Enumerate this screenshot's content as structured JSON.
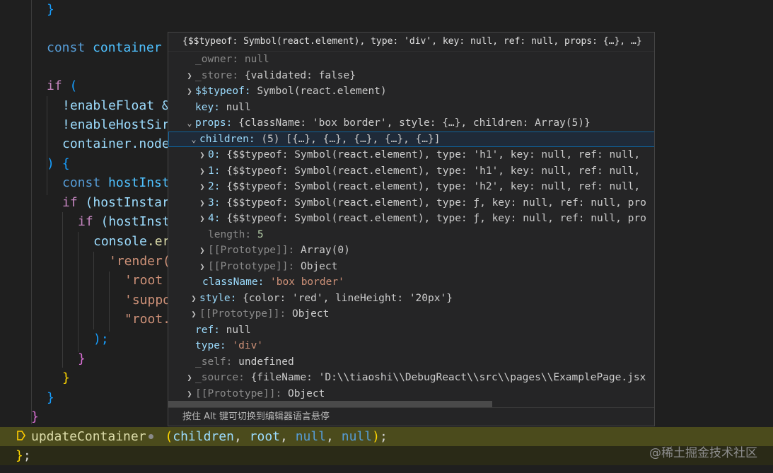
{
  "code": {
    "l1_brace": "}",
    "l2_const": "const",
    "l2_name": "container",
    "l3_if": "if",
    "l3_paren": "(",
    "l4_text": "!enableFloat &",
    "l5_text": "!enableHostSir",
    "l6_obj": "container",
    "l6_rest": ".node",
    "l7_close": ")",
    "l7_brace": "{",
    "l8_const": "const",
    "l8_name": "hostInst",
    "l9_if": "if",
    "l9_rest": "(hostInstar",
    "l10_if": "if",
    "l10_rest": "(hostInst",
    "l11_obj": "console",
    "l11_rest": ".er",
    "l12_str": "'render(",
    "l13_str": "'root",
    "l14_str": "'suppo",
    "l15_str": "\"root.",
    "l16_close": ");",
    "l17_brace": "}",
    "l18_brace": "}",
    "l19_brace": "}",
    "l20_brace": "}",
    "l21_fn": "updateContainer",
    "l21_open": "(",
    "l21_a1": "children",
    "l21_c1": ", ",
    "l21_a2": "root",
    "l21_c2": ", ",
    "l21_a3": "null",
    "l21_c3": ", ",
    "l21_a4": "null",
    "l21_close": ")",
    "l21_semi": ";",
    "l22_brace": "}",
    "l22_semi": ";"
  },
  "hover": {
    "title": "{$$typeof: Symbol(react.element), type: 'div', key: null, ref: null, props: {…}, …}",
    "footer": "按住 Alt 键可切换到编辑器语言悬停",
    "rows": [
      {
        "key": "_owner",
        "value": "null"
      },
      {
        "key": "_store",
        "value": "{validated: false}"
      },
      {
        "key": "$$typeof",
        "value": "Symbol(react.element)"
      },
      {
        "key": "key",
        "value": "null"
      },
      {
        "key": "props",
        "value": "{className: 'box border', style: {…}, children: Array(5)}"
      },
      {
        "key": "children",
        "value": "(5) [{…}, {…}, {…}, {…}, {…}]"
      },
      {
        "key": "0",
        "value": "{$$typeof: Symbol(react.element), type: 'h1', key: null, ref: null,"
      },
      {
        "key": "1",
        "value": "{$$typeof: Symbol(react.element), type: 'h1', key: null, ref: null,"
      },
      {
        "key": "2",
        "value": "{$$typeof: Symbol(react.element), type: 'h2', key: null, ref: null,"
      },
      {
        "key": "3",
        "value": "{$$typeof: Symbol(react.element), type: ƒ, key: null, ref: null, pro"
      },
      {
        "key": "4",
        "value": "{$$typeof: Symbol(react.element), type: ƒ, key: null, ref: null, pro"
      },
      {
        "key": "length",
        "value": "5"
      },
      {
        "key": "[[Prototype]]",
        "value": "Array(0)"
      },
      {
        "key": "[[Prototype]]",
        "value": "Object"
      },
      {
        "key": "className",
        "value": "'box border'"
      },
      {
        "key": "style",
        "value": "{color: 'red', lineHeight: '20px'}"
      },
      {
        "key": "[[Prototype]]",
        "value": "Object"
      },
      {
        "key": "ref",
        "value": "null"
      },
      {
        "key": "type",
        "value": "'div'"
      },
      {
        "key": "_self",
        "value": "undefined"
      },
      {
        "key": "_source",
        "value": "{fileName: 'D:\\\\tiaoshi\\\\DebugReact\\\\src\\\\pages\\\\ExamplePage.jsx"
      },
      {
        "key": "[[Prototype]]",
        "value": "Object"
      }
    ]
  },
  "watermark": "@稀土掘金技术社区",
  "colors": {
    "editor_bg": "#1f1f1f",
    "hover_bg": "#252526",
    "highlight": "#4b4b1c",
    "keyword": "#569cd6",
    "variable": "#9cdcfe",
    "string": "#ce9178"
  }
}
